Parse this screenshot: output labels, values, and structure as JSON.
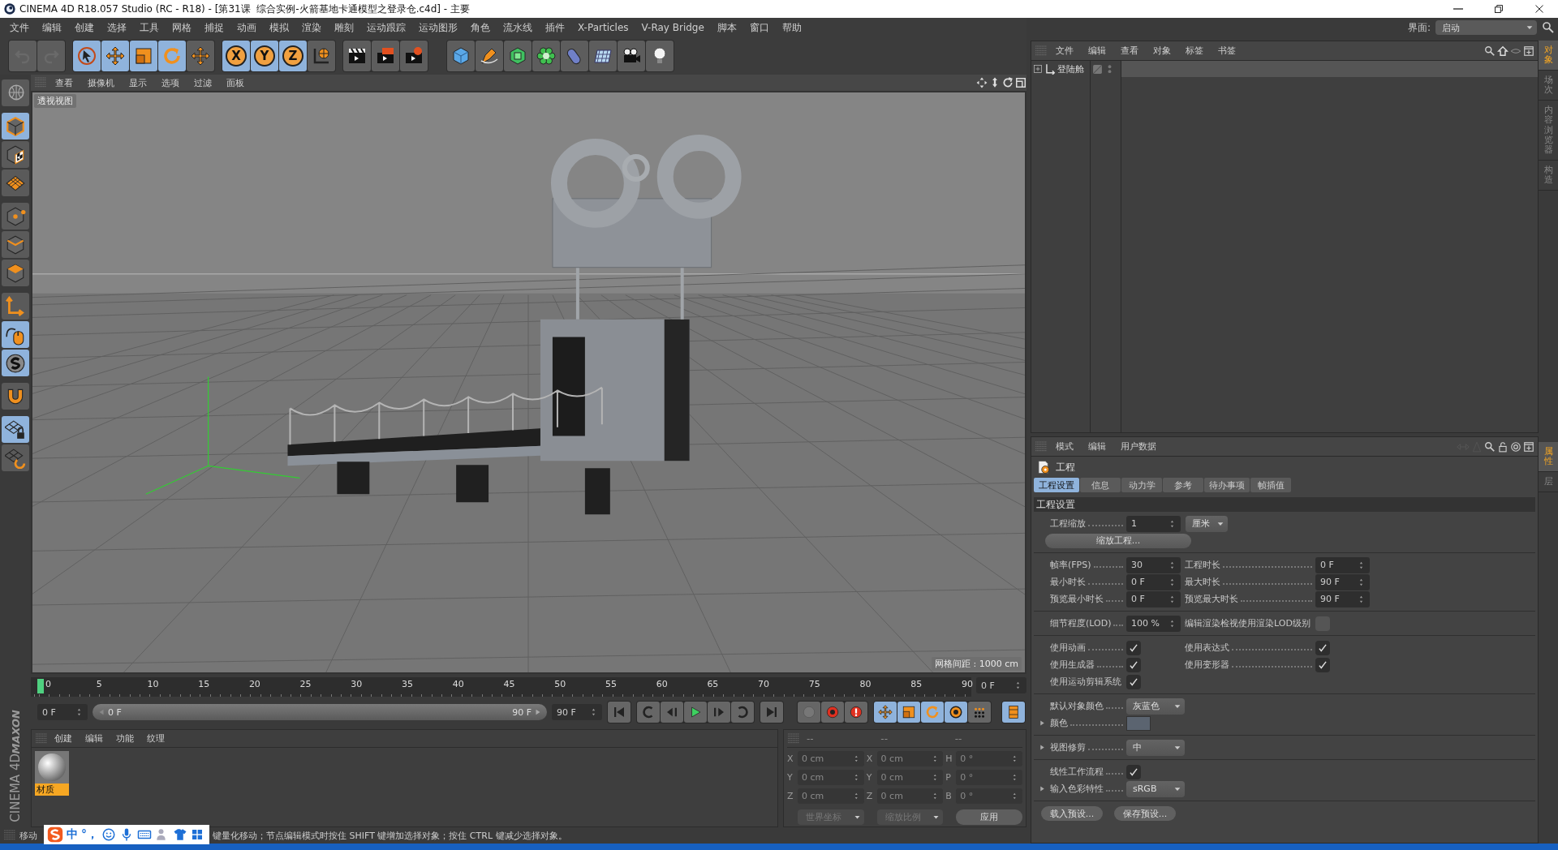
{
  "window": {
    "title": "CINEMA 4D R18.057 Studio (RC - R18) - [第31课  综合实例-火箭基地卡通模型之登录仓.c4d] - 主要"
  },
  "menu": [
    "文件",
    "编辑",
    "创建",
    "选择",
    "工具",
    "网格",
    "捕捉",
    "动画",
    "模拟",
    "渲染",
    "雕刻",
    "运动跟踪",
    "运动图形",
    "角色",
    "流水线",
    "插件",
    "X-Particles",
    "V-Ray Bridge",
    "脚本",
    "窗口",
    "帮助"
  ],
  "layout": {
    "label": "界面:",
    "value": "启动"
  },
  "toolbar": [
    [
      {
        "on": false
      },
      {
        "on": false
      }
    ],
    [
      {
        "on": true
      },
      {
        "on": true
      },
      {
        "on": true
      },
      {
        "on": true
      },
      {
        "on": false
      }
    ],
    [
      {
        "label": "X",
        "on": true
      },
      {
        "label": "Y",
        "on": true
      },
      {
        "label": "Z",
        "on": true
      },
      {
        "on": false
      }
    ],
    [
      {
        "on": false
      },
      {
        "on": false
      },
      {
        "on": false
      }
    ],
    [
      {
        "on": false
      },
      {
        "on": false
      },
      {
        "on": false
      },
      {
        "on": false
      },
      {
        "on": false
      },
      {
        "on": false
      },
      {
        "on": false
      },
      {
        "on": false
      }
    ]
  ],
  "modes": [
    {
      "on": false
    },
    {
      "on": true
    },
    {
      "on": false
    },
    {
      "on": false
    },
    {
      "on": false
    },
    {
      "on": false
    },
    {
      "on": false
    },
    {
      "on": false
    },
    {
      "on": true
    },
    {
      "on": true
    },
    {
      "on": false
    },
    {
      "on": true
    },
    {
      "on": false
    }
  ],
  "viewport": {
    "menu": [
      "查看",
      "摄像机",
      "显示",
      "选项",
      "过滤",
      "面板"
    ],
    "view_name": "透视视图",
    "grid_info": "网格间距 : 1000 cm"
  },
  "timeline": {
    "ticks": [
      "0",
      "5",
      "10",
      "15",
      "20",
      "25",
      "30",
      "35",
      "40",
      "45",
      "50",
      "55",
      "60",
      "65",
      "70",
      "75",
      "80",
      "85",
      "90"
    ],
    "playhead": {
      "level": 0
    },
    "current_frame": "0 F",
    "start": "0 F",
    "range_start": "0 F",
    "range_end": "90 F",
    "end": "90 F",
    "tools": [
      {
        "on": true
      },
      {
        "on": true
      },
      {
        "on": true
      },
      {
        "on": true
      },
      {
        "on": false
      },
      {
        "on": true
      }
    ]
  },
  "materials": {
    "menu": [
      "创建",
      "编辑",
      "功能",
      "纹理"
    ],
    "items": [
      {
        "name": "材质",
        "selected": true
      }
    ]
  },
  "coordinates": {
    "headers": [
      "--",
      "--",
      "--"
    ],
    "rows": [
      [
        {
          "axis": "X",
          "value": "0 cm"
        },
        {
          "axis": "X",
          "value": "0 cm"
        },
        {
          "axis": "H",
          "value": "0 °"
        }
      ],
      [
        {
          "axis": "Y",
          "value": "0 cm"
        },
        {
          "axis": "Y",
          "value": "0 cm"
        },
        {
          "axis": "P",
          "value": "0 °"
        }
      ],
      [
        {
          "axis": "Z",
          "value": "0 cm"
        },
        {
          "axis": "Z",
          "value": "0 cm"
        },
        {
          "axis": "B",
          "value": "0 °"
        }
      ]
    ],
    "selects": [
      "世界坐标",
      "缩放比例"
    ],
    "apply": "应用"
  },
  "status": {
    "mode": "移动",
    "text": "键量化移动；节点编辑模式时按住 SHIFT 键增加选择对象；按住 CTRL 键减少选择对象。"
  },
  "ime": {
    "items": [
      "中",
      "°，"
    ]
  },
  "brand": [
    "MAXON",
    "CINEMA 4D"
  ],
  "objects": {
    "menu": [
      "文件",
      "编辑",
      "查看",
      "对象",
      "标签",
      "书签"
    ],
    "items": [
      {
        "name": "登陆舱",
        "expanded": false
      }
    ]
  },
  "side_tabs_top": [
    {
      "label": "对象",
      "selected": true
    },
    {
      "label": "场次",
      "selected": false
    },
    {
      "label": "内容浏览器",
      "selected": false
    },
    {
      "label": "构造",
      "selected": false
    }
  ],
  "side_tabs_bottom": [
    {
      "label": "属性",
      "selected": true
    },
    {
      "label": "层",
      "selected": false
    }
  ],
  "attributes": {
    "menu": [
      "模式",
      "编辑",
      "用户数据"
    ],
    "title": "工程",
    "tabs": [
      {
        "label": "工程设置",
        "selected": true
      },
      {
        "label": "信息",
        "selected": false
      },
      {
        "label": "动力学",
        "selected": false
      },
      {
        "label": "参考",
        "selected": false
      },
      {
        "label": "待办事项",
        "selected": false
      },
      {
        "label": "帧插值",
        "selected": false
      }
    ],
    "section": "工程设置",
    "groups": [
      [
        [
          {
            "kind": "number",
            "label": "工程缩放",
            "value": "1",
            "unit": "厘米"
          }
        ],
        [
          {
            "kind": "button",
            "label": "缩放工程..."
          }
        ]
      ],
      [
        [
          {
            "kind": "number",
            "label": "帧率(FPS)",
            "value": "30"
          },
          {
            "kind": "number",
            "label": "工程时长",
            "value": "0 F"
          }
        ],
        [
          {
            "kind": "number",
            "label": "最小时长",
            "value": "0 F"
          },
          {
            "kind": "number",
            "label": "最大时长",
            "value": "90 F"
          }
        ],
        [
          {
            "kind": "number",
            "label": "预览最小时长",
            "value": "0 F"
          },
          {
            "kind": "number",
            "label": "预览最大时长",
            "value": "90 F"
          }
        ]
      ],
      [
        [
          {
            "kind": "number",
            "label": "细节程度(LOD)",
            "value": "100 %"
          },
          {
            "kind": "check",
            "label": "编辑渲染检视使用渲染LOD级别",
            "checked": false
          }
        ]
      ],
      [
        [
          {
            "kind": "check",
            "label": "使用动画",
            "checked": true
          },
          {
            "kind": "check",
            "label": "使用表达式",
            "checked": true
          }
        ],
        [
          {
            "kind": "check",
            "label": "使用生成器",
            "checked": true
          },
          {
            "kind": "check",
            "label": "使用变形器",
            "checked": true
          }
        ],
        [
          {
            "kind": "check",
            "label": "使用运动剪辑系统",
            "checked": true
          }
        ]
      ],
      [
        [
          {
            "kind": "select",
            "label": "默认对象颜色",
            "value": "灰蓝色"
          }
        ],
        [
          {
            "kind": "color",
            "label": "颜色",
            "color": "#5b6470",
            "expanded": false
          }
        ]
      ],
      [
        [
          {
            "kind": "select",
            "label": "视图修剪",
            "value": "中",
            "expanded": false
          }
        ]
      ],
      [
        [
          {
            "kind": "check",
            "label": "线性工作流程",
            "checked": true
          }
        ],
        [
          {
            "kind": "select",
            "label": "输入色彩特性",
            "value": "sRGB",
            "expanded": false
          }
        ]
      ]
    ],
    "presets": [
      "载入预设...",
      "保存预设..."
    ]
  }
}
